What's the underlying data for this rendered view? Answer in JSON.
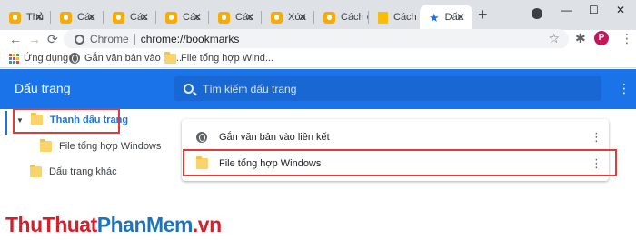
{
  "browser": {
    "tabs": [
      {
        "label": "Thủ",
        "favicon": "yellow-bulb-icon"
      },
      {
        "label": "Các",
        "favicon": "yellow-bulb-icon"
      },
      {
        "label": "Các",
        "favicon": "yellow-bulb-icon"
      },
      {
        "label": "Các",
        "favicon": "yellow-bulb-icon"
      },
      {
        "label": "Các",
        "favicon": "yellow-bulb-icon"
      },
      {
        "label": "Xóa",
        "favicon": "yellow-bulb-icon"
      },
      {
        "label": "Cách ch",
        "favicon": "yellow-bulb-icon"
      },
      {
        "label": "Cách ch",
        "favicon": "yellow-doc-icon"
      },
      {
        "label": "Dấu",
        "favicon": "star-icon",
        "active": true
      }
    ],
    "tab_close": "✕",
    "new_tab": "+",
    "window_controls": {
      "minimize": "—",
      "maximize": "☐",
      "close": "✕"
    },
    "toolbar": {
      "back": "←",
      "forward": "→",
      "reload": "⟳",
      "site_chip": "Chrome",
      "url": "chrome://bookmarks",
      "star": "☆",
      "extensions": "✱",
      "avatar_letter": "P",
      "menu": "⋮"
    },
    "bookmarks_bar": {
      "apps_label": "Ứng dụng",
      "items": [
        {
          "label": "Gắn văn bản vào liê...",
          "icon": "globe-icon"
        },
        {
          "label": "File tổng hợp Wind...",
          "icon": "folder-icon"
        }
      ]
    }
  },
  "bookmarks_page": {
    "title": "Dấu trang",
    "search_placeholder": "Tìm kiếm dấu trang",
    "menu": "⋮",
    "sidebar": {
      "expander": "▼",
      "bookmarks_bar_folder": "Thanh dấu trang",
      "subfolder": "File tổng hợp Windows",
      "other_bookmarks": "Dấu trang khác"
    },
    "list": [
      {
        "label": "Gắn văn bản vào liên kết",
        "icon": "globe-icon",
        "menu": "⋮"
      },
      {
        "label": "File tổng hợp Windows",
        "icon": "folder-icon",
        "menu": "⋮"
      }
    ]
  },
  "watermark": {
    "part1": "Thu",
    "part2": "Thuat",
    "part3": "Phan",
    "part4": "Mem",
    "part5": ".vn"
  },
  "colors": {
    "accent": "#1a73e8",
    "highlight_box": "#e53935",
    "folder": "#fbd36b"
  }
}
